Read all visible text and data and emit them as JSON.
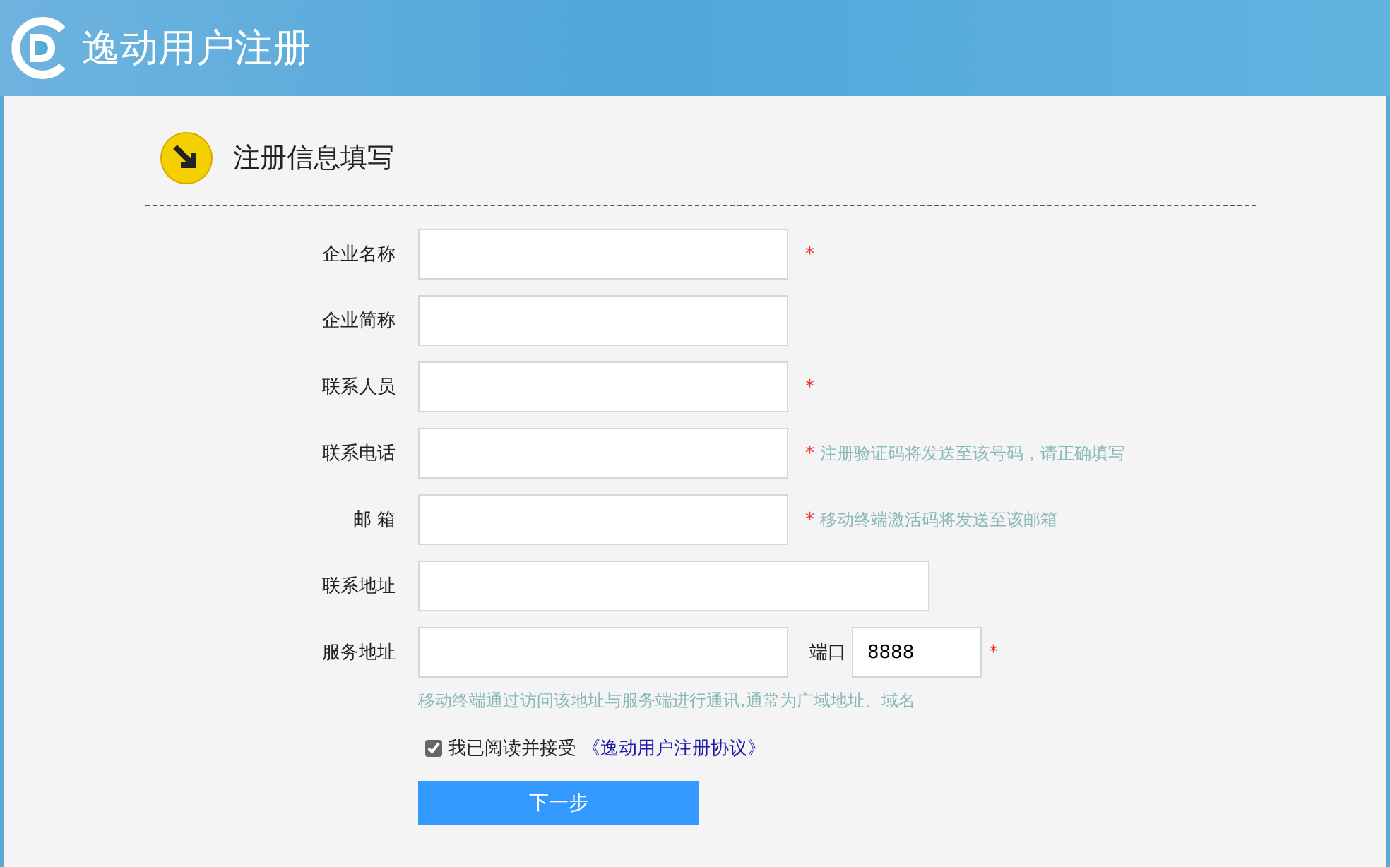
{
  "header": {
    "title": "逸动用户注册"
  },
  "section": {
    "title": "注册信息填写"
  },
  "fields": [
    {
      "label": "企业名称",
      "kind": "text",
      "mark": "*"
    },
    {
      "label": "企业简称",
      "kind": "text"
    },
    {
      "label": "联系人员",
      "kind": "text",
      "mark": "*"
    },
    {
      "label": "联系电话",
      "kind": "text",
      "mark": "*",
      "hint": "注册验证码将发送至该号码，请正确填写"
    },
    {
      "label": "邮 箱",
      "kind": "text",
      "mark": "*",
      "hint": "移动终端激活码将发送至该邮箱"
    },
    {
      "label": "联系地址",
      "kind": "wide"
    },
    {
      "label": "服务地址",
      "kind": "text",
      "port": {
        "label": "端口",
        "value": "8888",
        "mark": "*"
      },
      "note": "移动终端通过访问该地址与服务端进行通讯,通常为广域地址、域名"
    }
  ],
  "agreement": {
    "checked": true,
    "text": "我已阅读并接受",
    "link": "《逸动用户注册协议》"
  },
  "submit": "下一步"
}
